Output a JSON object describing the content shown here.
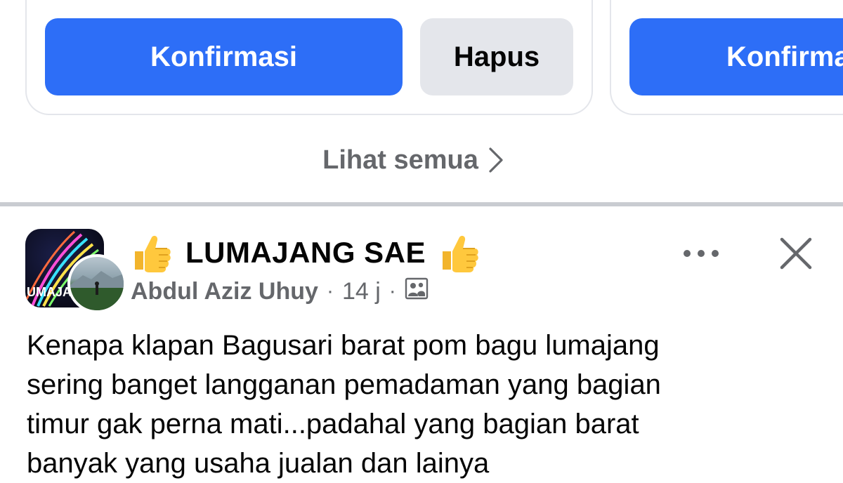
{
  "suggestion_cards": {
    "left": {
      "confirm_label": "Konfirmasi",
      "delete_label": "Hapus"
    },
    "right": {
      "confirm_label": "Konfirmasi"
    }
  },
  "see_all": {
    "label": "Lihat semua",
    "icon": "chevron-right-icon"
  },
  "post": {
    "group_name": "LUMAJANG SAE",
    "group_name_emoji": "👍",
    "author": "Abdul Aziz Uhuy",
    "time": "14 j",
    "separator": "·",
    "audience_icon": "group-audience-icon",
    "avatar_text": "UMAJAN",
    "text": "Kenapa klapan Bagusari barat pom bagu lumajang\nsering banget langganan pemadaman yang bagian\ntimur gak perna mati...padahal yang  bagian barat\nbanyak yang usaha jualan dan lainya",
    "more_icon": "more-horizontal-icon",
    "close_icon": "close-icon"
  },
  "colors": {
    "primary": "#2d6ef7",
    "secondary_button": "#e4e6eb",
    "muted_text": "#65676b",
    "divider": "#c9ccd1"
  }
}
